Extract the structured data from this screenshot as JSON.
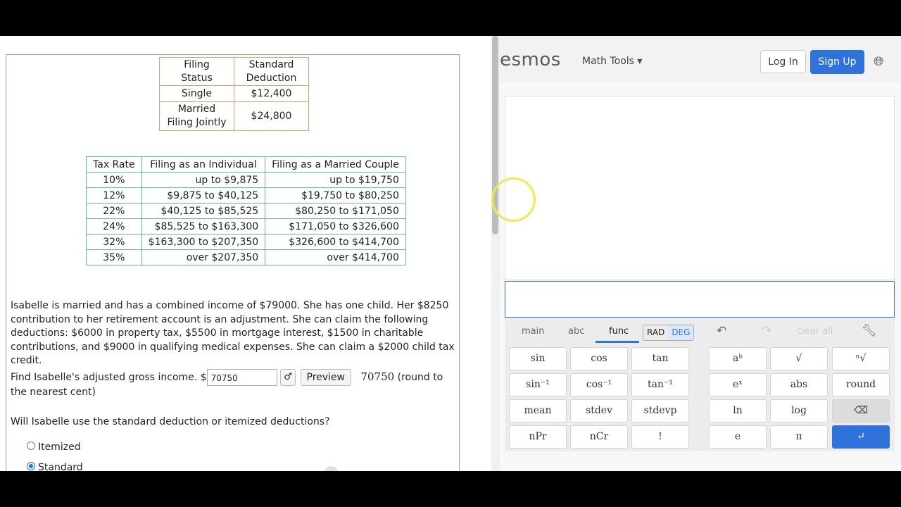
{
  "deduction_table": {
    "headers": [
      "Filing Status",
      "Standard Deduction"
    ],
    "rows": [
      [
        "Single",
        "$12,400"
      ],
      [
        "Married Filing Jointly",
        "$24,800"
      ]
    ]
  },
  "tax_table": {
    "headers": [
      "Tax Rate",
      "Filing as an Individual",
      "Filing as a Married Couple"
    ],
    "rows": [
      [
        "10%",
        "up to $9,875",
        "up to $19,750"
      ],
      [
        "12%",
        "$9,875 to $40,125",
        "$19,750 to $80,250"
      ],
      [
        "22%",
        "$40,125 to $85,525",
        "$80,250 to $171,050"
      ],
      [
        "24%",
        "$85,525 to $163,300",
        "$171,050 to $326,600"
      ],
      [
        "32%",
        "$163,300 to $207,350",
        "$326,600 to $414,700"
      ],
      [
        "35%",
        "over $207,350",
        "over $414,700"
      ]
    ]
  },
  "problem_text": "Isabelle is married and has a combined income of $79000. She has one child. Her $8250 contribution to her retirement account is an adjustment. She can claim the following deductions: $6000 in property tax, $5500 in mortgage interest, $1500 in charitable contributions, and $9000 in qualifying medical expenses. She can claim a $2000 child tax credit.",
  "agi_question": {
    "prefix": "Find Isabelle's adjusted gross income. $",
    "input_value": "70750",
    "preview_label": "Preview",
    "preview_value": "70750",
    "suffix": " (round to the nearest cent)"
  },
  "deduction_question": "Will Isabelle use the standard deduction or itemized deductions?",
  "radio_options": [
    {
      "label": "Itemized",
      "checked": false
    },
    {
      "label": "Standard",
      "checked": true
    }
  ],
  "calculator": {
    "logo": "esmos",
    "math_tools_label": "Math Tools",
    "login_label": "Log In",
    "signup_label": "Sign Up",
    "tabs": [
      "main",
      "abc",
      "func"
    ],
    "active_tab": "func",
    "angle_modes": [
      "RAD",
      "DEG"
    ],
    "clear_all_label": "clear all",
    "keys_left": [
      [
        "sin",
        "cos",
        "tan"
      ],
      [
        "sin⁻¹",
        "cos⁻¹",
        "tan⁻¹"
      ],
      [
        "mean",
        "stdev",
        "stdevp"
      ],
      [
        "nPr",
        "nCr",
        "!"
      ]
    ],
    "keys_right": [
      [
        "aᵇ",
        "√",
        "ⁿ√"
      ],
      [
        "eˣ",
        "abs",
        "round"
      ],
      [
        "ln",
        "log",
        "⌫"
      ],
      [
        "e",
        "π",
        "↵"
      ]
    ],
    "accent_color": "#2f72dc"
  }
}
